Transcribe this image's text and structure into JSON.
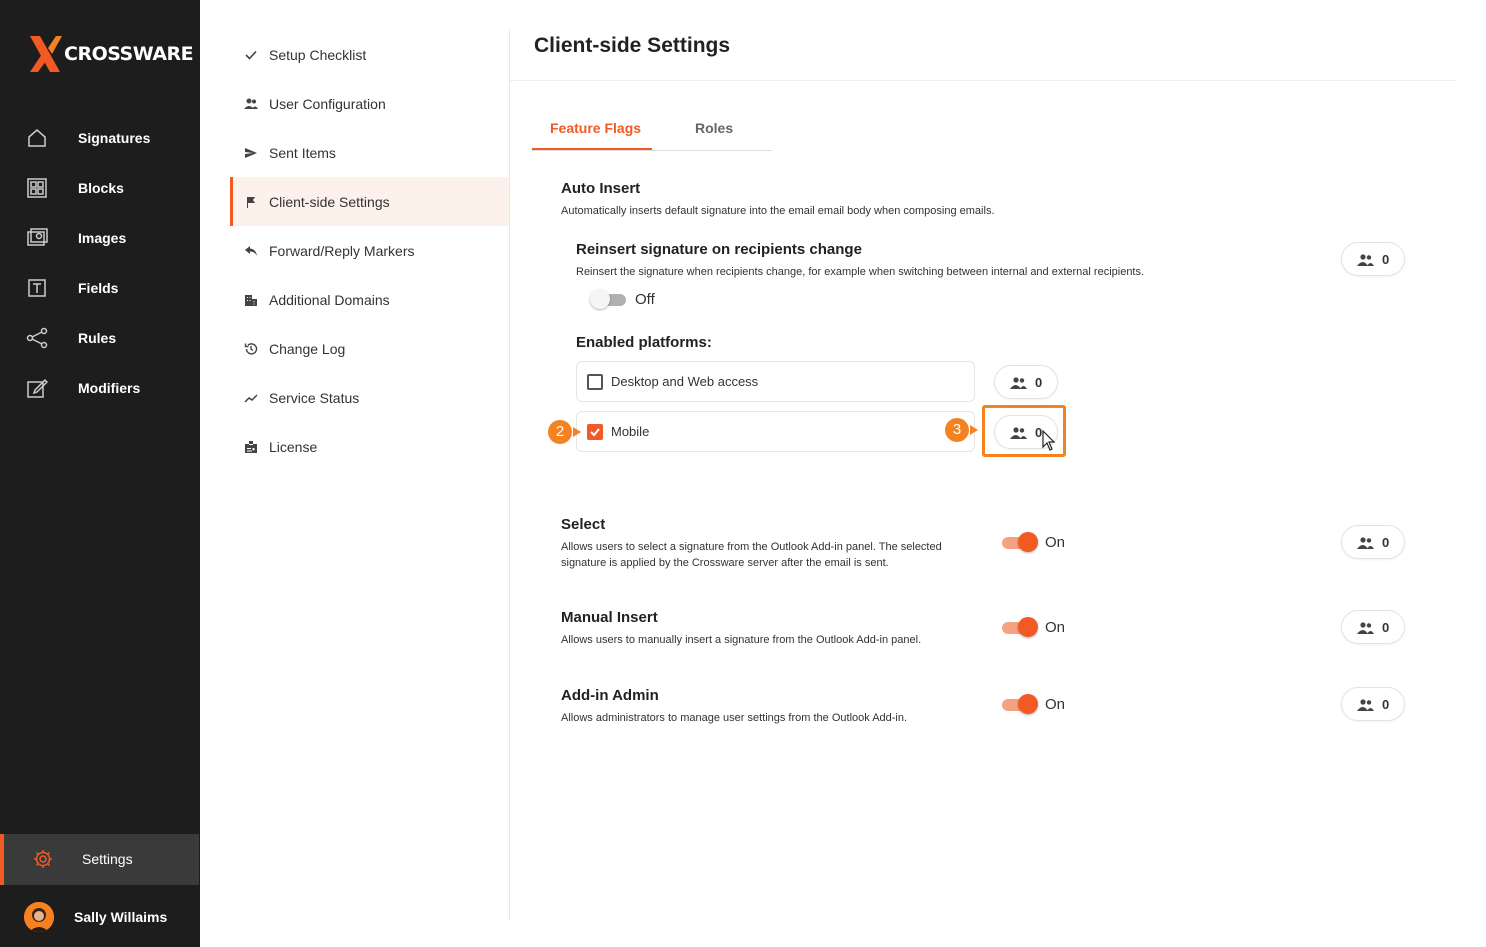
{
  "brand": {
    "logo_text": "CROSSWARE",
    "accent": "#f15a22"
  },
  "sidebar": {
    "items": [
      {
        "label": "Signatures",
        "icon": "home-icon"
      },
      {
        "label": "Blocks",
        "icon": "blocks-icon"
      },
      {
        "label": "Images",
        "icon": "images-icon"
      },
      {
        "label": "Fields",
        "icon": "fields-icon"
      },
      {
        "label": "Rules",
        "icon": "rules-icon"
      },
      {
        "label": "Modifiers",
        "icon": "modifiers-icon"
      }
    ],
    "settings_label": "Settings",
    "user_name": "Sally Willaims"
  },
  "submenu": {
    "items": [
      {
        "label": "Setup Checklist",
        "icon": "check-icon"
      },
      {
        "label": "User Configuration",
        "icon": "users-icon"
      },
      {
        "label": "Sent Items",
        "icon": "send-icon"
      },
      {
        "label": "Client-side Settings",
        "icon": "flag-icon",
        "active": true
      },
      {
        "label": "Forward/Reply Markers",
        "icon": "reply-icon"
      },
      {
        "label": "Additional Domains",
        "icon": "building-icon"
      },
      {
        "label": "Change Log",
        "icon": "history-icon"
      },
      {
        "label": "Service Status",
        "icon": "trend-icon"
      },
      {
        "label": "License",
        "icon": "badge-icon"
      }
    ]
  },
  "main": {
    "title": "Client-side Settings",
    "tabs": [
      {
        "label": "Feature Flags",
        "active": true
      },
      {
        "label": "Roles"
      }
    ],
    "auto_insert": {
      "title": "Auto Insert",
      "desc": "Automatically inserts default signature into the email email body when composing emails.",
      "reinsert": {
        "title": "Reinsert signature on recipients change",
        "desc": "Reinsert the signature when recipients change, for example when switching between internal and external recipients.",
        "toggle_label": "Off",
        "count": "0"
      },
      "platforms_title": "Enabled platforms:",
      "platforms": [
        {
          "label": "Desktop and Web access",
          "checked": false,
          "count": "0"
        },
        {
          "label": "Mobile",
          "checked": true,
          "count": "0"
        }
      ]
    },
    "select": {
      "title": "Select",
      "desc": "Allows users to select a signature from the Outlook Add-in panel. The selected signature is applied by the Crossware server after the email is sent.",
      "toggle_label": "On",
      "count": "0"
    },
    "manual_insert": {
      "title": "Manual Insert",
      "desc": "Allows users to manually insert a signature from the Outlook Add-in panel.",
      "toggle_label": "On",
      "count": "0"
    },
    "addin_admin": {
      "title": "Add-in Admin",
      "desc": "Allows administrators to manage user settings from the Outlook Add-in.",
      "toggle_label": "On",
      "count": "0"
    }
  },
  "annotations": {
    "marker_2": "2",
    "marker_3": "3"
  }
}
